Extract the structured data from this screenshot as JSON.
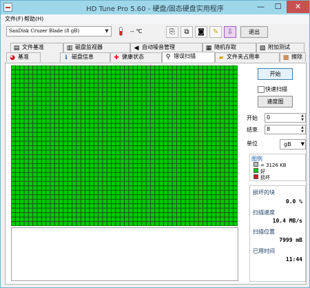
{
  "window": {
    "title": "HD Tune Pro 5.60 - 硬盘/固态硬盘实用程序",
    "min_label": "—",
    "max_label": "☐",
    "close_label": "✕"
  },
  "menu": {
    "file": "文件(F)",
    "help": "帮助(H)"
  },
  "toolbar": {
    "drive": "SanDisk Cruzer Blade (8 gB)",
    "temperature": "-- ℃",
    "exit_label": "退出"
  },
  "tabs": {
    "row1": [
      {
        "label": "文件基准",
        "icon": "file-benchmark-icon"
      },
      {
        "label": "磁盘监视器",
        "icon": "disk-monitor-icon"
      },
      {
        "label": "自动噪音管理",
        "icon": "speaker-icon"
      },
      {
        "label": "随机存取",
        "icon": "random-access-icon"
      },
      {
        "label": "附加测试",
        "icon": "extra-tests-icon"
      }
    ],
    "row2": [
      {
        "label": "基准",
        "icon": "benchmark-icon"
      },
      {
        "label": "磁盘信息",
        "icon": "info-icon"
      },
      {
        "label": "健康状态",
        "icon": "health-icon"
      },
      {
        "label": "错误扫描",
        "icon": "magnifier-icon"
      },
      {
        "label": "文件夹占用率",
        "icon": "folder-icon"
      },
      {
        "label": "擦除",
        "icon": "erase-icon"
      }
    ],
    "active": "错误扫描"
  },
  "side": {
    "start_button": "开始",
    "quick_scan": "快速扫描",
    "map_button": "速度图",
    "start_label": "开始",
    "start_value": "0",
    "end_label": "结束",
    "end_value": "8",
    "unit_label": "单位",
    "unit_value": "gB"
  },
  "legend": {
    "title": "图例",
    "block_size": "= 3126 KB",
    "good": "好",
    "bad": "损坏",
    "good_color": "#00cc00",
    "bad_color": "#d22020"
  },
  "stats": {
    "damaged_label": "损坏的块",
    "damaged_value": "0.0 %",
    "speed_label": "扫描速度",
    "speed_value": "10.4 MB/s",
    "position_label": "扫描位置",
    "position_value": "7999 mB",
    "time_label": "已用时间",
    "time_value": "11:44"
  },
  "scan_grid": {
    "cell_color": "#00cc00",
    "line_color": "#1f4f1f",
    "columns": 52,
    "rows": 36
  }
}
